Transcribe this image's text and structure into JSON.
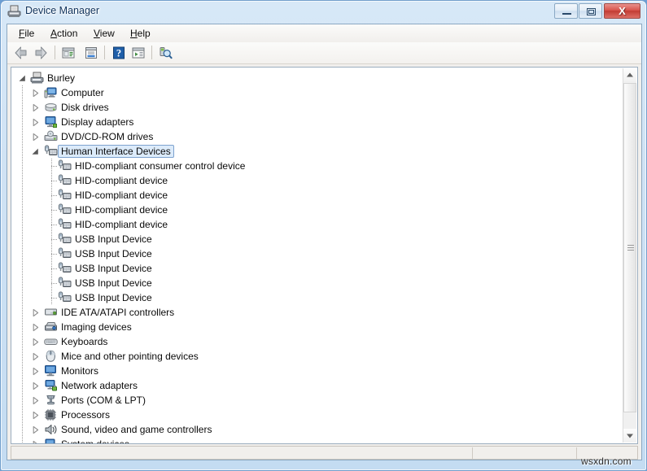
{
  "window": {
    "title": "Device Manager",
    "title_icon": "device-manager-icon",
    "controls": {
      "minimize": "Minimize",
      "restore": "Restore",
      "close": "X"
    }
  },
  "menu": [
    {
      "label": "File",
      "accel": "F"
    },
    {
      "label": "Action",
      "accel": "A"
    },
    {
      "label": "View",
      "accel": "V"
    },
    {
      "label": "Help",
      "accel": "H"
    }
  ],
  "toolbar": [
    {
      "name": "back-arrow-icon",
      "tooltip": "Back"
    },
    {
      "name": "forward-arrow-icon",
      "tooltip": "Forward"
    },
    {
      "name": "show-hide-console-tree-icon",
      "tooltip": "Show/Hide Console Tree"
    },
    {
      "name": "properties-icon",
      "tooltip": "Properties"
    },
    {
      "name": "help-icon",
      "tooltip": "Help"
    },
    {
      "name": "update-driver-icon",
      "tooltip": "Update Driver Software"
    },
    {
      "name": "scan-for-hardware-changes-icon",
      "tooltip": "Scan for hardware changes"
    }
  ],
  "tree": {
    "root": {
      "label": "Burley",
      "icon": "computer-root-icon",
      "expanded": true
    },
    "nodes": [
      {
        "label": "Computer",
        "icon": "computer-icon",
        "level": 1,
        "expanded": false,
        "selected": false
      },
      {
        "label": "Disk drives",
        "icon": "disk-drive-icon",
        "level": 1,
        "expanded": false,
        "selected": false
      },
      {
        "label": "Display adapters",
        "icon": "display-adapter-icon",
        "level": 1,
        "expanded": false,
        "selected": false
      },
      {
        "label": "DVD/CD-ROM drives",
        "icon": "dvd-cdrom-icon",
        "level": 1,
        "expanded": false,
        "selected": false
      },
      {
        "label": "Human Interface Devices",
        "icon": "hid-icon",
        "level": 1,
        "expanded": true,
        "selected": true
      },
      {
        "label": "HID-compliant consumer control device",
        "icon": "hid-device-icon",
        "level": 2,
        "expanded": null,
        "selected": false
      },
      {
        "label": "HID-compliant device",
        "icon": "hid-device-icon",
        "level": 2,
        "expanded": null,
        "selected": false
      },
      {
        "label": "HID-compliant device",
        "icon": "hid-device-icon",
        "level": 2,
        "expanded": null,
        "selected": false
      },
      {
        "label": "HID-compliant device",
        "icon": "hid-device-icon",
        "level": 2,
        "expanded": null,
        "selected": false
      },
      {
        "label": "HID-compliant device",
        "icon": "hid-device-icon",
        "level": 2,
        "expanded": null,
        "selected": false
      },
      {
        "label": "USB Input Device",
        "icon": "hid-device-icon",
        "level": 2,
        "expanded": null,
        "selected": false
      },
      {
        "label": "USB Input Device",
        "icon": "hid-device-icon",
        "level": 2,
        "expanded": null,
        "selected": false
      },
      {
        "label": "USB Input Device",
        "icon": "hid-device-icon",
        "level": 2,
        "expanded": null,
        "selected": false
      },
      {
        "label": "USB Input Device",
        "icon": "hid-device-icon",
        "level": 2,
        "expanded": null,
        "selected": false
      },
      {
        "label": "USB Input Device",
        "icon": "hid-device-icon",
        "level": 2,
        "expanded": null,
        "selected": false
      },
      {
        "label": "IDE ATA/ATAPI controllers",
        "icon": "ide-controller-icon",
        "level": 1,
        "expanded": false,
        "selected": false
      },
      {
        "label": "Imaging devices",
        "icon": "imaging-device-icon",
        "level": 1,
        "expanded": false,
        "selected": false
      },
      {
        "label": "Keyboards",
        "icon": "keyboard-icon",
        "level": 1,
        "expanded": false,
        "selected": false
      },
      {
        "label": "Mice and other pointing devices",
        "icon": "mouse-icon",
        "level": 1,
        "expanded": false,
        "selected": false
      },
      {
        "label": "Monitors",
        "icon": "monitor-icon",
        "level": 1,
        "expanded": false,
        "selected": false
      },
      {
        "label": "Network adapters",
        "icon": "network-adapter-icon",
        "level": 1,
        "expanded": false,
        "selected": false
      },
      {
        "label": "Ports (COM & LPT)",
        "icon": "port-icon",
        "level": 1,
        "expanded": false,
        "selected": false
      },
      {
        "label": "Processors",
        "icon": "processor-icon",
        "level": 1,
        "expanded": false,
        "selected": false
      },
      {
        "label": "Sound, video and game controllers",
        "icon": "sound-controller-icon",
        "level": 1,
        "expanded": false,
        "selected": false
      },
      {
        "label": "System devices",
        "icon": "system-device-icon",
        "level": 1,
        "expanded": false,
        "selected": false
      }
    ]
  },
  "scrollbar": {
    "up_arrow": "scroll-up-arrow",
    "down_arrow": "scroll-down-arrow",
    "thumb": "scroll-thumb"
  },
  "statusbar": {
    "left": "",
    "middle": "",
    "right": ""
  },
  "watermark": "wsxdn.com",
  "colors": {
    "selection_fill": "#dcebfa",
    "selection_border": "#7da2ce",
    "close_button": "#c23c33",
    "frame": "#cfe2f4",
    "tree_background": "#ffffff"
  }
}
